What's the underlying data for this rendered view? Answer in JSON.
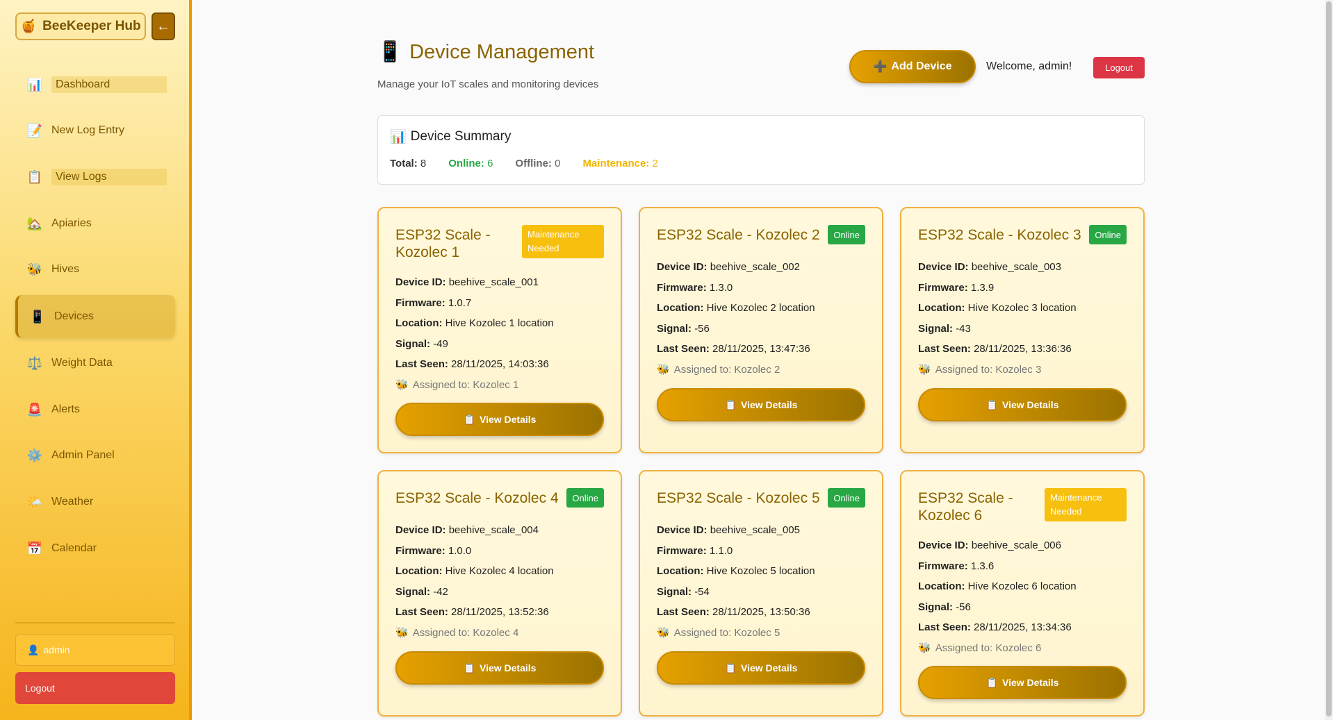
{
  "sidebar": {
    "brand": "BeeKeeper Hub",
    "collapse_glyph": "←",
    "items": [
      {
        "label": "Dashboard",
        "icon": "📊"
      },
      {
        "label": "New Log Entry",
        "icon": "📝"
      },
      {
        "label": "View Logs",
        "icon": "📋"
      },
      {
        "label": "Apiaries",
        "icon": "🏡"
      },
      {
        "label": "Hives",
        "icon": "🐝"
      },
      {
        "label": "Devices",
        "icon": "📱"
      },
      {
        "label": "Weight Data",
        "icon": "⚖️"
      },
      {
        "label": "Alerts",
        "icon": "🚨"
      },
      {
        "label": "Admin Panel",
        "icon": "⚙️"
      },
      {
        "label": "Weather",
        "icon": "🌤️"
      },
      {
        "label": "Calendar",
        "icon": "📅"
      }
    ],
    "user": "admin",
    "logout": "Logout"
  },
  "header": {
    "title": "Device Management",
    "title_icon": "📱",
    "subtitle": "Manage your IoT scales and monitoring devices",
    "add_device": "Add Device",
    "welcome": "Welcome, admin!",
    "logout": "Logout"
  },
  "summary": {
    "title": "Device Summary",
    "total_label": "Total:",
    "total": "8",
    "online_label": "Online:",
    "online": "6",
    "offline_label": "Offline:",
    "offline": "0",
    "maintenance_label": "Maintenance:",
    "maintenance": "2"
  },
  "labels": {
    "device_id": "Device ID:",
    "firmware": "Firmware:",
    "location": "Location:",
    "signal": "Signal:",
    "last_seen": "Last Seen:",
    "view_details": "View Details"
  },
  "devices": [
    {
      "name": "ESP32 Scale - Kozolec 1",
      "status": "Maintenance Needed",
      "id": "beehive_scale_001",
      "firmware": "1.0.7",
      "location": "Hive Kozolec 1 location",
      "signal": "-49",
      "last_seen": "28/11/2025, 14:03:36",
      "assigned": "Assigned to: Kozolec 1"
    },
    {
      "name": "ESP32 Scale - Kozolec 2",
      "status": "Online",
      "id": "beehive_scale_002",
      "firmware": "1.3.0",
      "location": "Hive Kozolec 2 location",
      "signal": "-56",
      "last_seen": "28/11/2025, 13:47:36",
      "assigned": "Assigned to: Kozolec 2"
    },
    {
      "name": "ESP32 Scale - Kozolec 3",
      "status": "Online",
      "id": "beehive_scale_003",
      "firmware": "1.3.9",
      "location": "Hive Kozolec 3 location",
      "signal": "-43",
      "last_seen": "28/11/2025, 13:36:36",
      "assigned": "Assigned to: Kozolec 3"
    },
    {
      "name": "ESP32 Scale - Kozolec 4",
      "status": "Online",
      "id": "beehive_scale_004",
      "firmware": "1.0.0",
      "location": "Hive Kozolec 4 location",
      "signal": "-42",
      "last_seen": "28/11/2025, 13:52:36",
      "assigned": "Assigned to: Kozolec 4"
    },
    {
      "name": "ESP32 Scale - Kozolec 5",
      "status": "Online",
      "id": "beehive_scale_005",
      "firmware": "1.1.0",
      "location": "Hive Kozolec 5 location",
      "signal": "-54",
      "last_seen": "28/11/2025, 13:50:36",
      "assigned": "Assigned to: Kozolec 5"
    },
    {
      "name": "ESP32 Scale - Kozolec 6",
      "status": "Maintenance Needed",
      "id": "beehive_scale_006",
      "firmware": "1.3.6",
      "location": "Hive Kozolec 6 location",
      "signal": "-56",
      "last_seen": "28/11/2025, 13:34:36",
      "assigned": "Assigned to: Kozolec 6"
    }
  ],
  "colors": {
    "accent": "#e6a100",
    "online": "#28a745",
    "maintenance": "#f7bf0e",
    "logout": "#dc3545"
  }
}
